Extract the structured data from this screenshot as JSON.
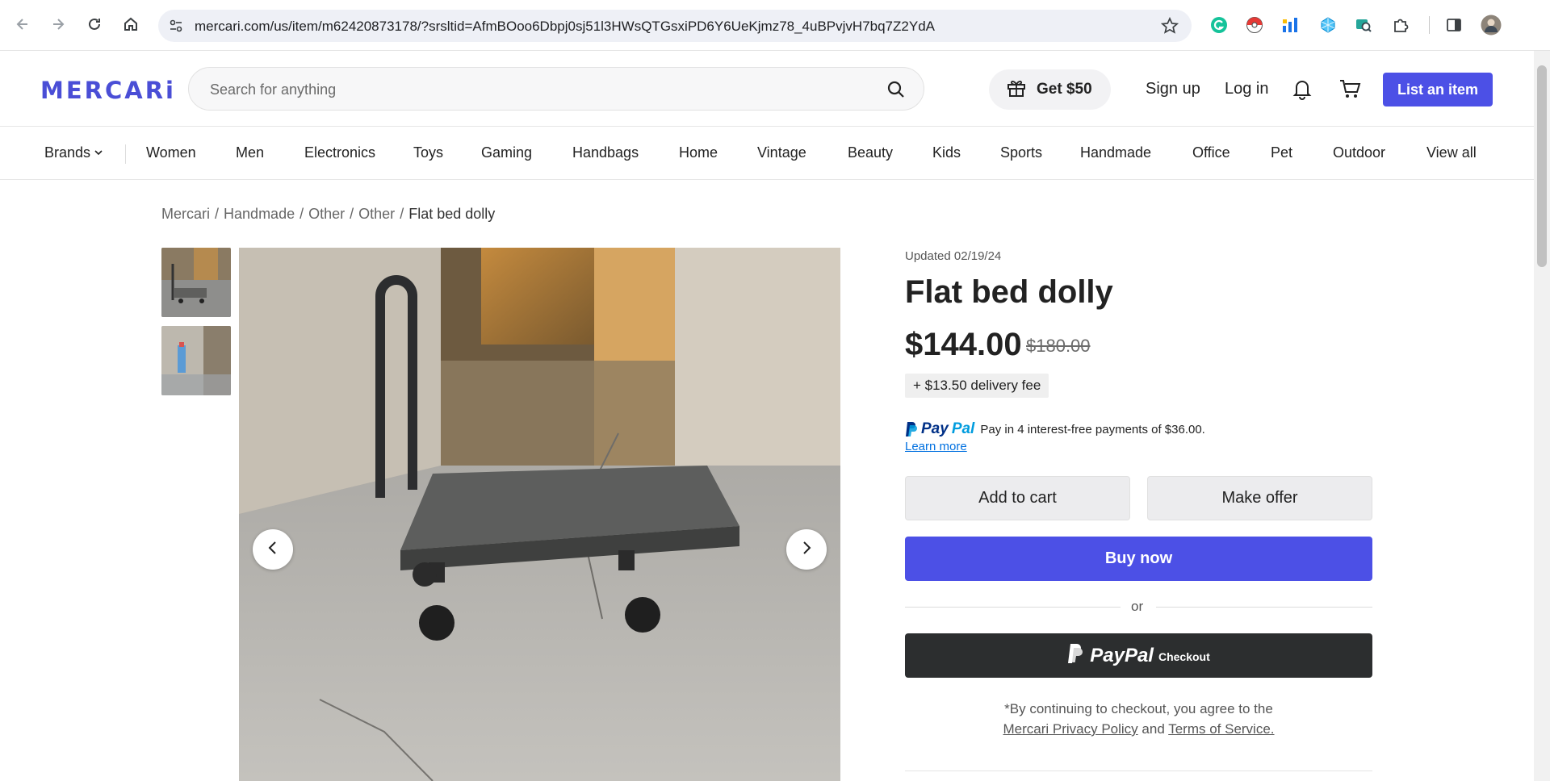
{
  "browser": {
    "url": "mercari.com/us/item/m62420873178/?srsltid=AfmBOoo6Dbpj0sj51l3HWsQTGsxiPD6Y6UeKjmz78_4uBPvjvH7bq7Z2YdA",
    "icons": [
      "back-icon",
      "forward-icon",
      "reload-icon",
      "home-icon",
      "site-info-icon",
      "bookmark-star-icon",
      "grammarly-icon",
      "pokeball-icon",
      "chart-extension-icon",
      "puzzle-extension-icon",
      "side-panel-icon",
      "profile-avatar"
    ]
  },
  "header": {
    "logo": "MERCARi",
    "search_placeholder": "Search for anything",
    "get50": "Get $50",
    "sign_up": "Sign up",
    "log_in": "Log in",
    "list_item": "List an item",
    "accent_color": "#4c50e6"
  },
  "categories": {
    "brands": "Brands",
    "items": [
      "Women",
      "Men",
      "Electronics",
      "Toys",
      "Gaming",
      "Handbags",
      "Home",
      "Vintage",
      "Beauty",
      "Kids",
      "Sports",
      "Handmade",
      "Office",
      "Pet",
      "Outdoor",
      "View all"
    ]
  },
  "breadcrumb": {
    "items": [
      "Mercari",
      "Handmade",
      "Other",
      "Other"
    ],
    "separator": "/",
    "current": "Flat bed dolly"
  },
  "product": {
    "updated": "Updated 02/19/24",
    "title": "Flat bed dolly",
    "price": "$144.00",
    "original_price": "$180.00",
    "delivery_fee": "+ $13.50 delivery fee",
    "paypal_pay": "Pay",
    "paypal_pal": "Pal",
    "paypal_text": "Pay in 4 interest-free payments of $36.00.",
    "learn_more": "Learn more",
    "add_to_cart": "Add to cart",
    "make_offer": "Make offer",
    "buy_now": "Buy now",
    "or": "or",
    "paypal_checkout_brand": "PayPal",
    "paypal_checkout_label": "Checkout",
    "terms_prefix": "*By continuing to checkout, you agree to the",
    "privacy_policy": "Mercari Privacy Policy",
    "terms_and": "and",
    "terms_of_service": "Terms of Service."
  }
}
